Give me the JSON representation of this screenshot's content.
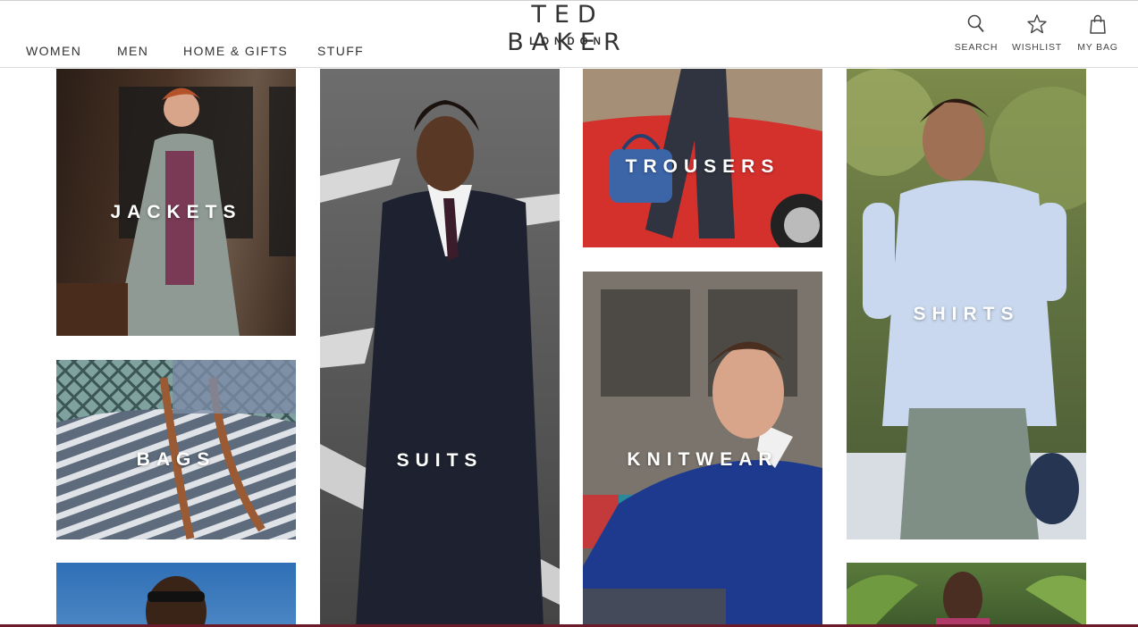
{
  "nav": {
    "items": [
      "WOMEN",
      "MEN",
      "HOME & GIFTS",
      "STUFF"
    ]
  },
  "logo": {
    "main": "TED BAKER",
    "sub": "LONDON"
  },
  "tools": {
    "search": "SEARCH",
    "wishlist": "WISHLIST",
    "bag": "MY BAG"
  },
  "tiles": {
    "jackets": "JACKETS",
    "suits": "SUITS",
    "trousers": "TROUSERS",
    "shirts": "SHIRTS",
    "bags": "BAGS",
    "knitwear": "KNITWEAR"
  },
  "colors": {
    "text": "#333333",
    "accent": "#6b1a2a"
  }
}
